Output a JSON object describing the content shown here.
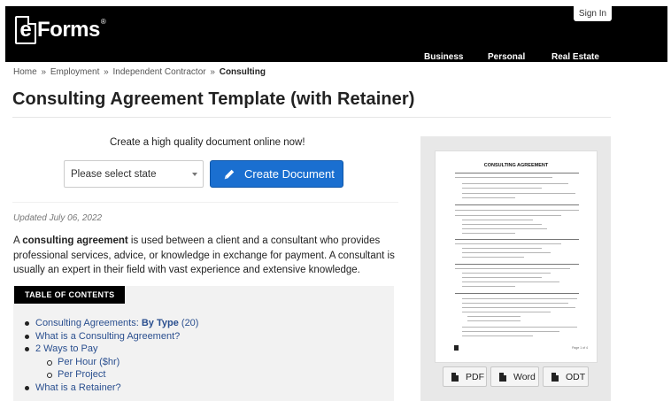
{
  "header": {
    "logo_prefix": "e",
    "logo_text": "Forms",
    "logo_reg": "®",
    "signin_label": "Sign In",
    "nav": {
      "business": "Business",
      "personal": "Personal",
      "real_estate": "Real Estate"
    }
  },
  "breadcrumb": {
    "home": "Home",
    "employment": "Employment",
    "independent_contractor": "Independent Contractor",
    "current": "Consulting",
    "separator": "»"
  },
  "page_title": "Consulting Agreement Template (with Retainer)",
  "create": {
    "prompt": "Create a high quality document online now!",
    "state_placeholder": "Please select state",
    "button_label": "Create Document"
  },
  "updated": "Updated July 06, 2022",
  "intro": {
    "lead": "A ",
    "term": "consulting agreement",
    "body": " is used between a client and a consultant who provides professional services, advice, or knowledge in exchange for payment. A consultant is usually an expert in their field with vast experience and extensive knowledge."
  },
  "toc": {
    "header": "TABLE OF CONTENTS",
    "item1_prefix": "Consulting Agreements: ",
    "item1_bold": "By Type",
    "item1_suffix": " (20)",
    "item2": "What is a Consulting Agreement?",
    "item3": "2 Ways to Pay",
    "item3_sub1": "Per Hour ($hr)",
    "item3_sub2": "Per Project",
    "item4": "What is a Retainer?"
  },
  "preview": {
    "doc_title": "CONSULTING AGREEMENT",
    "page_label": "Page 1 of 4"
  },
  "downloads": {
    "pdf": "PDF",
    "word": "Word",
    "odt": "ODT"
  },
  "colors": {
    "header_bg": "#000000",
    "primary_button": "#1a6fd0",
    "link": "#2a4f8f"
  }
}
